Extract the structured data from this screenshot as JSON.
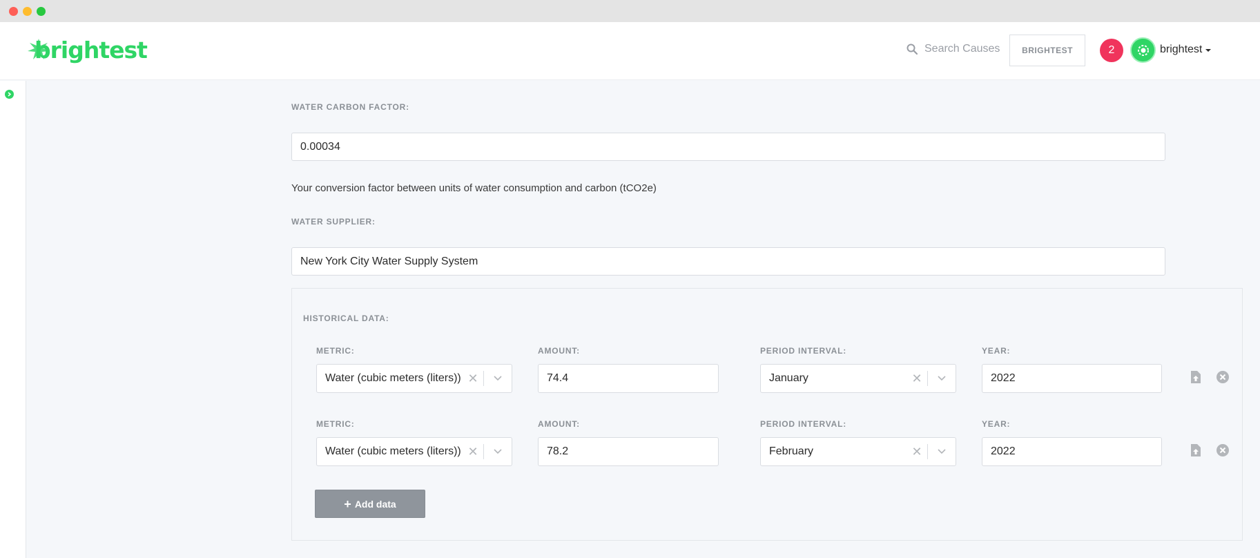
{
  "header": {
    "brand": "brightest",
    "search_placeholder": "Search Causes",
    "org_button": "BRIGHTEST",
    "notification_count": "2",
    "user_name": "brightest"
  },
  "form": {
    "carbon_factor_label": "WATER CARBON FACTOR:",
    "carbon_factor_value": "0.00034",
    "carbon_factor_help": "Your conversion factor between units of water consumption and carbon (tCO2e)",
    "supplier_label": "WATER SUPPLIER:",
    "supplier_value": "New York City Water Supply System"
  },
  "historical": {
    "label": "HISTORICAL DATA:",
    "column_labels": {
      "metric": "METRIC:",
      "amount": "AMOUNT:",
      "period": "PERIOD INTERVAL:",
      "year": "YEAR:"
    },
    "rows": [
      {
        "metric": "Water (cubic meters (liters))",
        "amount": "74.4",
        "period": "January",
        "year": "2022"
      },
      {
        "metric": "Water (cubic meters (liters))",
        "amount": "78.2",
        "period": "February",
        "year": "2022"
      }
    ],
    "add_button": "Add data"
  },
  "colors": {
    "brand_green": "#2fd565",
    "badge_red": "#f0345c",
    "button_gray": "#8f959c"
  },
  "icons": {
    "search": "search-icon",
    "sidebar_toggle": "chevron-right-icon",
    "upload": "file-upload-icon",
    "remove": "close-circle-icon",
    "select_clear": "x-icon",
    "select_chevron": "chevron-down-icon"
  }
}
